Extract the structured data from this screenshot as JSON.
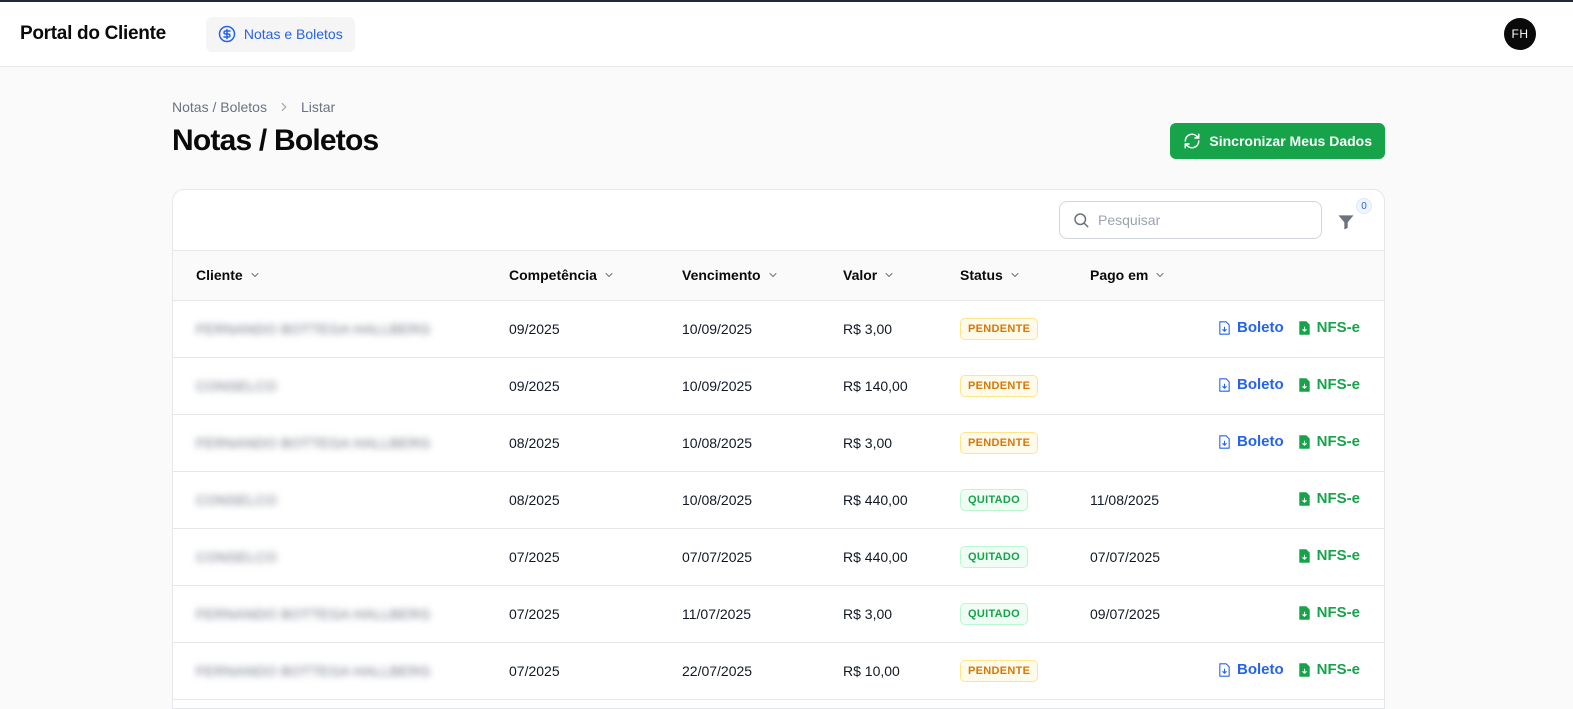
{
  "header": {
    "brand": "Portal do Cliente",
    "nav_item": "Notas e Boletos",
    "avatar_initials": "FH"
  },
  "breadcrumb": {
    "parent": "Notas / Boletos",
    "current": "Listar"
  },
  "page": {
    "title": "Notas / Boletos",
    "sync_label": "Sincronizar Meus Dados"
  },
  "search": {
    "placeholder": "Pesquisar",
    "value": ""
  },
  "filter": {
    "count": "0"
  },
  "columns": {
    "cliente": "Cliente",
    "competencia": "Competência",
    "vencimento": "Vencimento",
    "valor": "Valor",
    "status": "Status",
    "pago_em": "Pago em"
  },
  "actions": {
    "boleto": "Boleto",
    "nfse": "NFS-e"
  },
  "rows": [
    {
      "cliente": "FERNANDO BOTTEGA HALLBERG",
      "competencia": "09/2025",
      "vencimento": "10/09/2025",
      "valor": "R$ 3,00",
      "status": "PENDENTE",
      "pago_em": "",
      "boleto": true
    },
    {
      "cliente": "CONSELCO",
      "competencia": "09/2025",
      "vencimento": "10/09/2025",
      "valor": "R$ 140,00",
      "status": "PENDENTE",
      "pago_em": "",
      "boleto": true
    },
    {
      "cliente": "FERNANDO BOTTEGA HALLBERG",
      "competencia": "08/2025",
      "vencimento": "10/08/2025",
      "valor": "R$ 3,00",
      "status": "PENDENTE",
      "pago_em": "",
      "boleto": true
    },
    {
      "cliente": "CONSELCO",
      "competencia": "08/2025",
      "vencimento": "10/08/2025",
      "valor": "R$ 440,00",
      "status": "QUITADO",
      "pago_em": "11/08/2025",
      "boleto": false
    },
    {
      "cliente": "CONSELCO",
      "competencia": "07/2025",
      "vencimento": "07/07/2025",
      "valor": "R$ 440,00",
      "status": "QUITADO",
      "pago_em": "07/07/2025",
      "boleto": false
    },
    {
      "cliente": "FERNANDO BOTTEGA HALLBERG",
      "competencia": "07/2025",
      "vencimento": "11/07/2025",
      "valor": "R$ 3,00",
      "status": "QUITADO",
      "pago_em": "09/07/2025",
      "boleto": false
    },
    {
      "cliente": "FERNANDO BOTTEGA HALLBERG",
      "competencia": "07/2025",
      "vencimento": "22/07/2025",
      "valor": "R$ 10,00",
      "status": "PENDENTE",
      "pago_em": "",
      "boleto": true
    }
  ]
}
